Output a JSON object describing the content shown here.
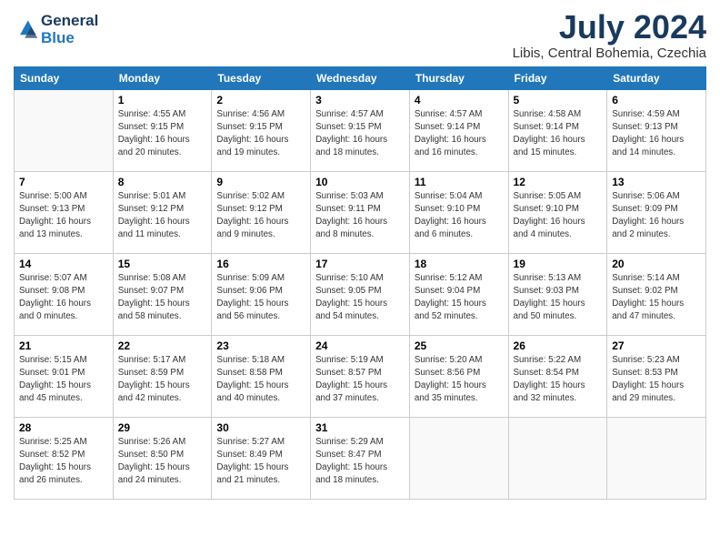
{
  "header": {
    "logo_line1": "General",
    "logo_line2": "Blue",
    "title": "July 2024",
    "subtitle": "Libis, Central Bohemia, Czechia"
  },
  "calendar": {
    "headers": [
      "Sunday",
      "Monday",
      "Tuesday",
      "Wednesday",
      "Thursday",
      "Friday",
      "Saturday"
    ],
    "weeks": [
      [
        {
          "day": "",
          "info": ""
        },
        {
          "day": "1",
          "info": "Sunrise: 4:55 AM\nSunset: 9:15 PM\nDaylight: 16 hours\nand 20 minutes."
        },
        {
          "day": "2",
          "info": "Sunrise: 4:56 AM\nSunset: 9:15 PM\nDaylight: 16 hours\nand 19 minutes."
        },
        {
          "day": "3",
          "info": "Sunrise: 4:57 AM\nSunset: 9:15 PM\nDaylight: 16 hours\nand 18 minutes."
        },
        {
          "day": "4",
          "info": "Sunrise: 4:57 AM\nSunset: 9:14 PM\nDaylight: 16 hours\nand 16 minutes."
        },
        {
          "day": "5",
          "info": "Sunrise: 4:58 AM\nSunset: 9:14 PM\nDaylight: 16 hours\nand 15 minutes."
        },
        {
          "day": "6",
          "info": "Sunrise: 4:59 AM\nSunset: 9:13 PM\nDaylight: 16 hours\nand 14 minutes."
        }
      ],
      [
        {
          "day": "7",
          "info": "Sunrise: 5:00 AM\nSunset: 9:13 PM\nDaylight: 16 hours\nand 13 minutes."
        },
        {
          "day": "8",
          "info": "Sunrise: 5:01 AM\nSunset: 9:12 PM\nDaylight: 16 hours\nand 11 minutes."
        },
        {
          "day": "9",
          "info": "Sunrise: 5:02 AM\nSunset: 9:12 PM\nDaylight: 16 hours\nand 9 minutes."
        },
        {
          "day": "10",
          "info": "Sunrise: 5:03 AM\nSunset: 9:11 PM\nDaylight: 16 hours\nand 8 minutes."
        },
        {
          "day": "11",
          "info": "Sunrise: 5:04 AM\nSunset: 9:10 PM\nDaylight: 16 hours\nand 6 minutes."
        },
        {
          "day": "12",
          "info": "Sunrise: 5:05 AM\nSunset: 9:10 PM\nDaylight: 16 hours\nand 4 minutes."
        },
        {
          "day": "13",
          "info": "Sunrise: 5:06 AM\nSunset: 9:09 PM\nDaylight: 16 hours\nand 2 minutes."
        }
      ],
      [
        {
          "day": "14",
          "info": "Sunrise: 5:07 AM\nSunset: 9:08 PM\nDaylight: 16 hours\nand 0 minutes."
        },
        {
          "day": "15",
          "info": "Sunrise: 5:08 AM\nSunset: 9:07 PM\nDaylight: 15 hours\nand 58 minutes."
        },
        {
          "day": "16",
          "info": "Sunrise: 5:09 AM\nSunset: 9:06 PM\nDaylight: 15 hours\nand 56 minutes."
        },
        {
          "day": "17",
          "info": "Sunrise: 5:10 AM\nSunset: 9:05 PM\nDaylight: 15 hours\nand 54 minutes."
        },
        {
          "day": "18",
          "info": "Sunrise: 5:12 AM\nSunset: 9:04 PM\nDaylight: 15 hours\nand 52 minutes."
        },
        {
          "day": "19",
          "info": "Sunrise: 5:13 AM\nSunset: 9:03 PM\nDaylight: 15 hours\nand 50 minutes."
        },
        {
          "day": "20",
          "info": "Sunrise: 5:14 AM\nSunset: 9:02 PM\nDaylight: 15 hours\nand 47 minutes."
        }
      ],
      [
        {
          "day": "21",
          "info": "Sunrise: 5:15 AM\nSunset: 9:01 PM\nDaylight: 15 hours\nand 45 minutes."
        },
        {
          "day": "22",
          "info": "Sunrise: 5:17 AM\nSunset: 8:59 PM\nDaylight: 15 hours\nand 42 minutes."
        },
        {
          "day": "23",
          "info": "Sunrise: 5:18 AM\nSunset: 8:58 PM\nDaylight: 15 hours\nand 40 minutes."
        },
        {
          "day": "24",
          "info": "Sunrise: 5:19 AM\nSunset: 8:57 PM\nDaylight: 15 hours\nand 37 minutes."
        },
        {
          "day": "25",
          "info": "Sunrise: 5:20 AM\nSunset: 8:56 PM\nDaylight: 15 hours\nand 35 minutes."
        },
        {
          "day": "26",
          "info": "Sunrise: 5:22 AM\nSunset: 8:54 PM\nDaylight: 15 hours\nand 32 minutes."
        },
        {
          "day": "27",
          "info": "Sunrise: 5:23 AM\nSunset: 8:53 PM\nDaylight: 15 hours\nand 29 minutes."
        }
      ],
      [
        {
          "day": "28",
          "info": "Sunrise: 5:25 AM\nSunset: 8:52 PM\nDaylight: 15 hours\nand 26 minutes."
        },
        {
          "day": "29",
          "info": "Sunrise: 5:26 AM\nSunset: 8:50 PM\nDaylight: 15 hours\nand 24 minutes."
        },
        {
          "day": "30",
          "info": "Sunrise: 5:27 AM\nSunset: 8:49 PM\nDaylight: 15 hours\nand 21 minutes."
        },
        {
          "day": "31",
          "info": "Sunrise: 5:29 AM\nSunset: 8:47 PM\nDaylight: 15 hours\nand 18 minutes."
        },
        {
          "day": "",
          "info": ""
        },
        {
          "day": "",
          "info": ""
        },
        {
          "day": "",
          "info": ""
        }
      ]
    ]
  }
}
